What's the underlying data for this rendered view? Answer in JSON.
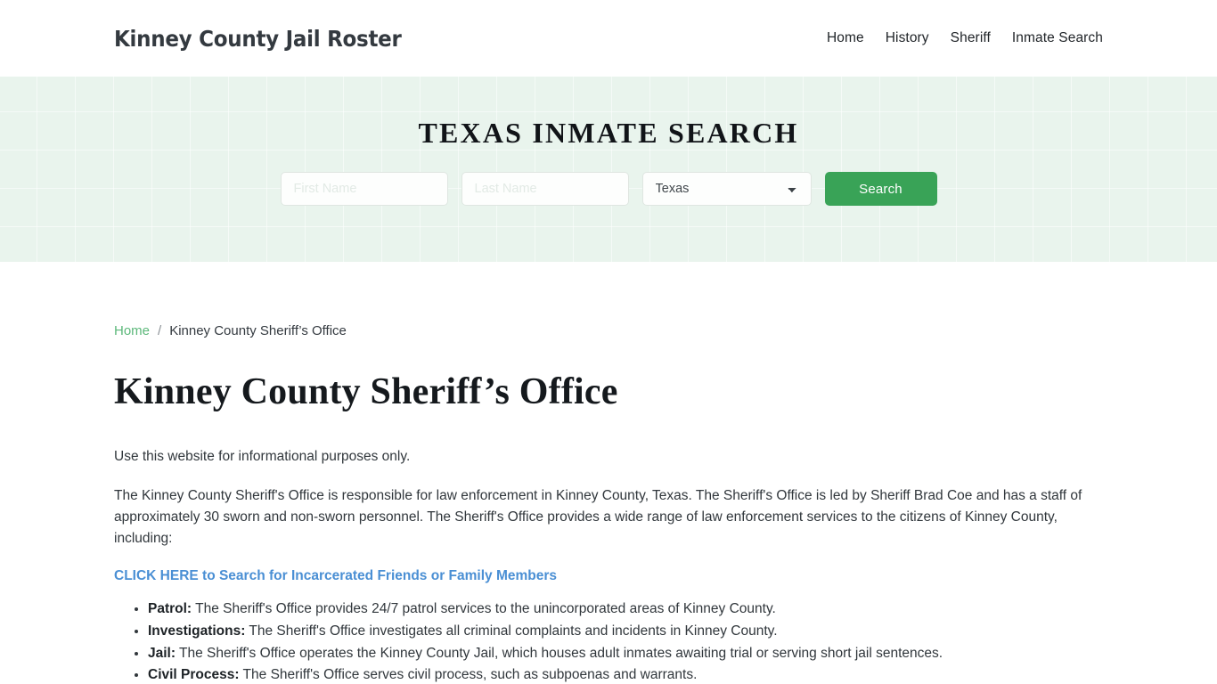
{
  "header": {
    "brand": "Kinney County Jail Roster",
    "nav": [
      {
        "label": "Home"
      },
      {
        "label": "History"
      },
      {
        "label": "Sheriff"
      },
      {
        "label": "Inmate Search"
      }
    ]
  },
  "hero": {
    "title": "TEXAS INMATE SEARCH",
    "first_name_placeholder": "First Name",
    "first_name_value": "",
    "last_name_placeholder": "Last Name",
    "last_name_value": "",
    "state_selected": "Texas",
    "state_options": [
      "Texas"
    ],
    "search_button": "Search",
    "button_color": "#39a357",
    "background_color": "#e9f4ed"
  },
  "breadcrumb": {
    "home": "Home",
    "separator": "/",
    "current": "Kinney County Sheriff’s Office",
    "link_color": "#5cb87a"
  },
  "main": {
    "page_title": "Kinney County Sheriff’s Office",
    "lede": "Use this website for informational purposes only.",
    "body": "The Kinney County Sheriff's Office is responsible for law enforcement in Kinney County, Texas. The Sheriff's Office is led by Sheriff Brad Coe and has a staff of approximately 30 sworn and non-sworn personnel. The Sheriff's Office provides a wide range of law enforcement services to the citizens of Kinney County, including:",
    "cta_link": "CLICK HERE to Search for Incarcerated Friends or Family Members",
    "cta_color": "#4a8fd4",
    "services": [
      {
        "term": "Patrol:",
        "description": " The Sheriff's Office provides 24/7 patrol services to the unincorporated areas of Kinney County."
      },
      {
        "term": "Investigations:",
        "description": " The Sheriff's Office investigates all criminal complaints and incidents in Kinney County."
      },
      {
        "term": "Jail:",
        "description": " The Sheriff's Office operates the Kinney County Jail, which houses adult inmates awaiting trial or serving short jail sentences."
      },
      {
        "term": "Civil Process:",
        "description": " The Sheriff's Office serves civil process, such as subpoenas and warrants."
      }
    ]
  }
}
